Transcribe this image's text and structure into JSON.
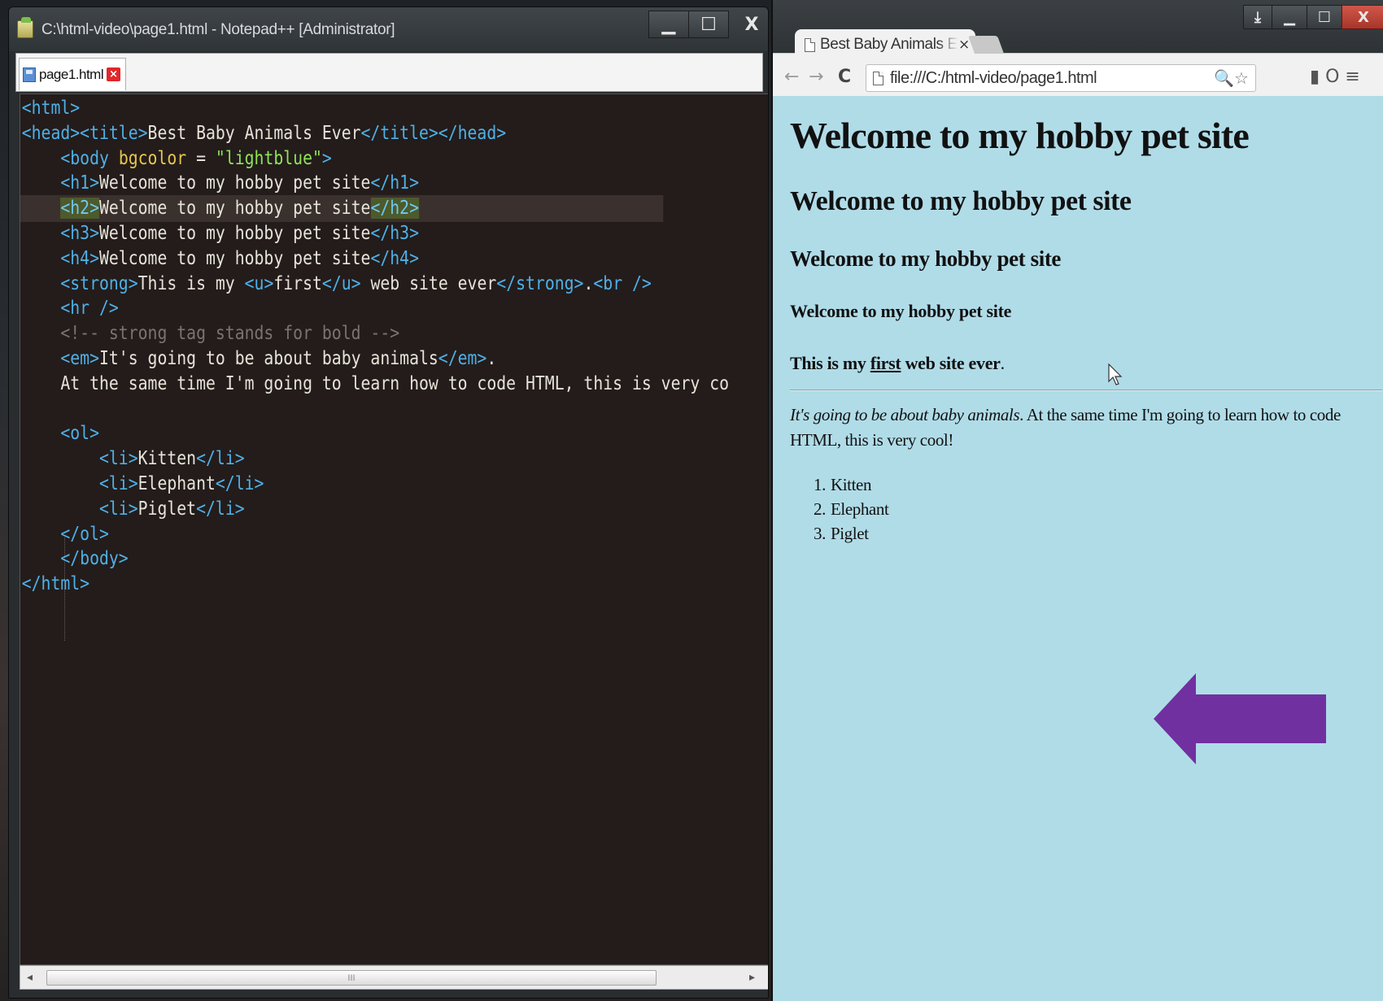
{
  "notepad": {
    "title": "C:\\html-video\\page1.html - Notepad++ [Administrator]",
    "tab_label": "page1.html",
    "controls": {
      "minimize": "▁",
      "maximize": "☐",
      "close": "X"
    },
    "scroll_left": "◂",
    "scroll_right": "▸",
    "scroll_grip": "III",
    "code": [
      [
        [
          "t",
          "<html>"
        ]
      ],
      [
        [
          "t",
          "<head><title>"
        ],
        [
          "o",
          "Best Baby Animals Ever"
        ],
        [
          "t",
          "</title></head>"
        ]
      ],
      [
        [
          "o",
          "    "
        ],
        [
          "t",
          "<body "
        ],
        [
          "a",
          "bgcolor"
        ],
        [
          "o",
          " = "
        ],
        [
          "s",
          "\"lightblue\""
        ],
        [
          "t",
          ">"
        ]
      ],
      [
        [
          "o",
          "    "
        ],
        [
          "t",
          "<h1>"
        ],
        [
          "o",
          "Welcome to my hobby pet site"
        ],
        [
          "t",
          "</h1>"
        ]
      ],
      [
        [
          "o",
          "    "
        ],
        [
          "tm",
          "<h2>"
        ],
        [
          "o",
          "Welcome to my hobby pet site"
        ],
        [
          "tm",
          "</h2>"
        ]
      ],
      [
        [
          "o",
          "    "
        ],
        [
          "t",
          "<h3>"
        ],
        [
          "o",
          "Welcome to my hobby pet site"
        ],
        [
          "t",
          "</h3>"
        ]
      ],
      [
        [
          "o",
          "    "
        ],
        [
          "t",
          "<h4>"
        ],
        [
          "o",
          "Welcome to my hobby pet site"
        ],
        [
          "t",
          "</h4>"
        ]
      ],
      [
        [
          "o",
          "    "
        ],
        [
          "t",
          "<strong>"
        ],
        [
          "o",
          "This is my "
        ],
        [
          "t",
          "<u>"
        ],
        [
          "o",
          "first"
        ],
        [
          "t",
          "</u>"
        ],
        [
          "o",
          " web site ever"
        ],
        [
          "t",
          "</strong>"
        ],
        [
          "o",
          "."
        ],
        [
          "t",
          "<br />"
        ]
      ],
      [
        [
          "o",
          "    "
        ],
        [
          "t",
          "<hr />"
        ]
      ],
      [
        [
          "o",
          "    "
        ],
        [
          "c",
          "<!-- strong tag stands for bold -->"
        ]
      ],
      [
        [
          "o",
          "    "
        ],
        [
          "t",
          "<em>"
        ],
        [
          "o",
          "It's going to be about baby animals"
        ],
        [
          "t",
          "</em>"
        ],
        [
          "o",
          "."
        ]
      ],
      [
        [
          "o",
          "    At the same time I'm going to learn how to code HTML, this is very co"
        ]
      ],
      [
        [
          "o",
          ""
        ]
      ],
      [
        [
          "o",
          "    "
        ],
        [
          "t",
          "<ol>"
        ]
      ],
      [
        [
          "o",
          "        "
        ],
        [
          "t",
          "<li>"
        ],
        [
          "o",
          "Kitten"
        ],
        [
          "t",
          "</li>"
        ]
      ],
      [
        [
          "o",
          "        "
        ],
        [
          "t",
          "<li>"
        ],
        [
          "o",
          "Elephant"
        ],
        [
          "t",
          "</li>"
        ]
      ],
      [
        [
          "o",
          "        "
        ],
        [
          "t",
          "<li>"
        ],
        [
          "o",
          "Piglet"
        ],
        [
          "t",
          "</li>"
        ]
      ],
      [
        [
          "o",
          "    "
        ],
        [
          "t",
          "</ol>"
        ]
      ],
      [
        [
          "o",
          "    "
        ],
        [
          "t",
          "</body>"
        ]
      ],
      [
        [
          "t",
          "</html>"
        ]
      ]
    ]
  },
  "chrome": {
    "tab_title": "Best Baby Animals Ever",
    "tab_close": "×",
    "url": "file:///C:/html-video/page1.html",
    "controls": {
      "download": "⤓",
      "minimize": "▁",
      "maximize": "☐",
      "close": "X"
    },
    "nav": {
      "back": "←",
      "forward": "→",
      "reload": "C"
    },
    "omni_icons": "🔍☆",
    "ext_icons": "▮ O ≡",
    "page": {
      "h1": "Welcome to my hobby pet site",
      "h2": "Welcome to my hobby pet site",
      "h3": "Welcome to my hobby pet site",
      "h4": "Welcome to my hobby pet site",
      "strong_prefix": "This is my ",
      "strong_underlined": "first",
      "strong_suffix": " web site ever",
      "strong_period": ".",
      "em_text": "It's going to be about baby animals",
      "para_rest": ". At the same time I'm going to learn how to code HTML, this is very cool!",
      "list": [
        {
          "num": "1.",
          "text": "Kitten"
        },
        {
          "num": "2.",
          "text": "Elephant"
        },
        {
          "num": "3.",
          "text": "Piglet"
        }
      ]
    }
  },
  "colors": {
    "page_bg": "#b0dce8",
    "editor_bg": "#231c1b",
    "tag": "#4fb0e6",
    "attr": "#e6c64e",
    "string": "#8fe25a",
    "comment": "#7b7370",
    "annotation_arrow": "#7030a0"
  }
}
